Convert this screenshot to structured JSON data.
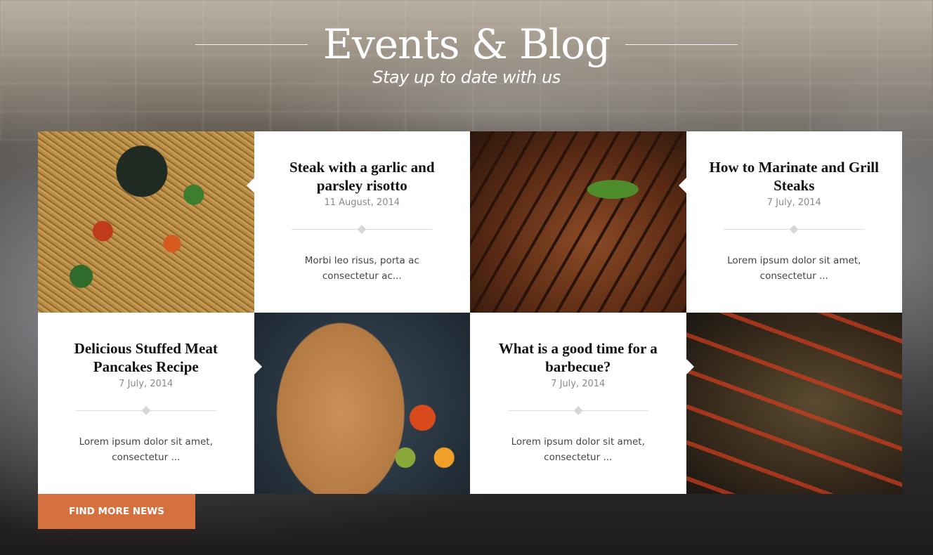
{
  "header": {
    "title": "Events & Blog",
    "subtitle": "Stay up to date with us"
  },
  "posts": [
    {
      "title": "Steak with a garlic and parsley risotto",
      "date": "11 August, 2014",
      "excerpt": "Morbi leo risus, porta ac consectetur ac..."
    },
    {
      "title": "How to Marinate and Grill Steaks",
      "date": "7 July, 2014",
      "excerpt": "Lorem ipsum dolor sit amet, consectetur ..."
    },
    {
      "title": "Delicious Stuffed Meat Pancakes Recipe",
      "date": "7 July, 2014",
      "excerpt": "Lorem ipsum dolor sit amet, consectetur ..."
    },
    {
      "title": "What is a good time for a barbecue?",
      "date": "7 July, 2014",
      "excerpt": "Lorem ipsum dolor sit amet, consectetur ..."
    }
  ],
  "cta": {
    "label": "FIND MORE NEWS"
  },
  "colors": {
    "accent": "#d5713f",
    "card_bg": "#ffffff",
    "date_text": "#8a8a8a"
  },
  "images": [
    "noodles-photo",
    "steak-photo",
    "crepe-photo",
    "skewers-photo"
  ]
}
